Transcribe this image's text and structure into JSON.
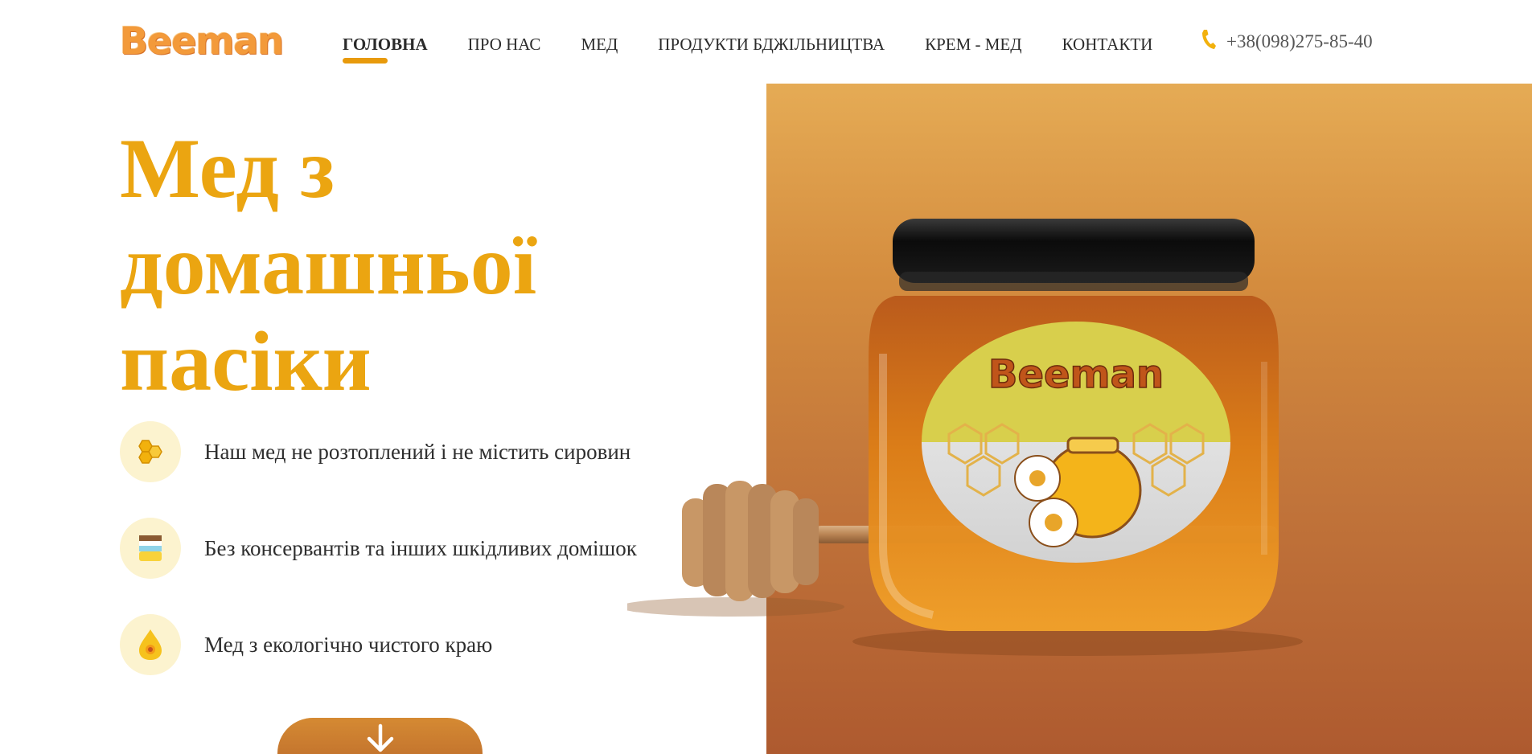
{
  "brand": {
    "logo_text": "Beeman",
    "jar_label": "Beeman"
  },
  "nav": {
    "items": [
      {
        "label": "ГОЛОВНА",
        "active": true
      },
      {
        "label": "ПРО НАС",
        "active": false
      },
      {
        "label": "МЕД",
        "active": false
      },
      {
        "label": "ПРОДУКТИ БДЖІЛЬНИЦТВА",
        "active": false
      },
      {
        "label": "КРЕМ - МЕД",
        "active": false
      },
      {
        "label": "КОНТАКТИ",
        "active": false
      }
    ],
    "phone": {
      "icon": "phone-icon",
      "number": "+38(098)275-85-40"
    }
  },
  "hero": {
    "headline_lines": [
      "Мед з",
      "домашньої",
      "пасіки"
    ],
    "features": [
      {
        "icon": "honeycomb-icon",
        "text": "Наш мед не розтоплений і не містить сировин"
      },
      {
        "icon": "honey-jar-icon",
        "text": "Без консервантів та інших шкідливих домішок"
      },
      {
        "icon": "honey-drop-flower-icon",
        "text": "Мед з екологічно чистого краю"
      }
    ],
    "scroll_button_icon": "arrow-down-icon"
  },
  "colors": {
    "accent": "#eba511",
    "nav_underline": "#e89a0c",
    "feature_icon_bg": "#fcf3cf",
    "panel_top": "#e5ab55",
    "panel_bottom": "#ae5a2f"
  }
}
